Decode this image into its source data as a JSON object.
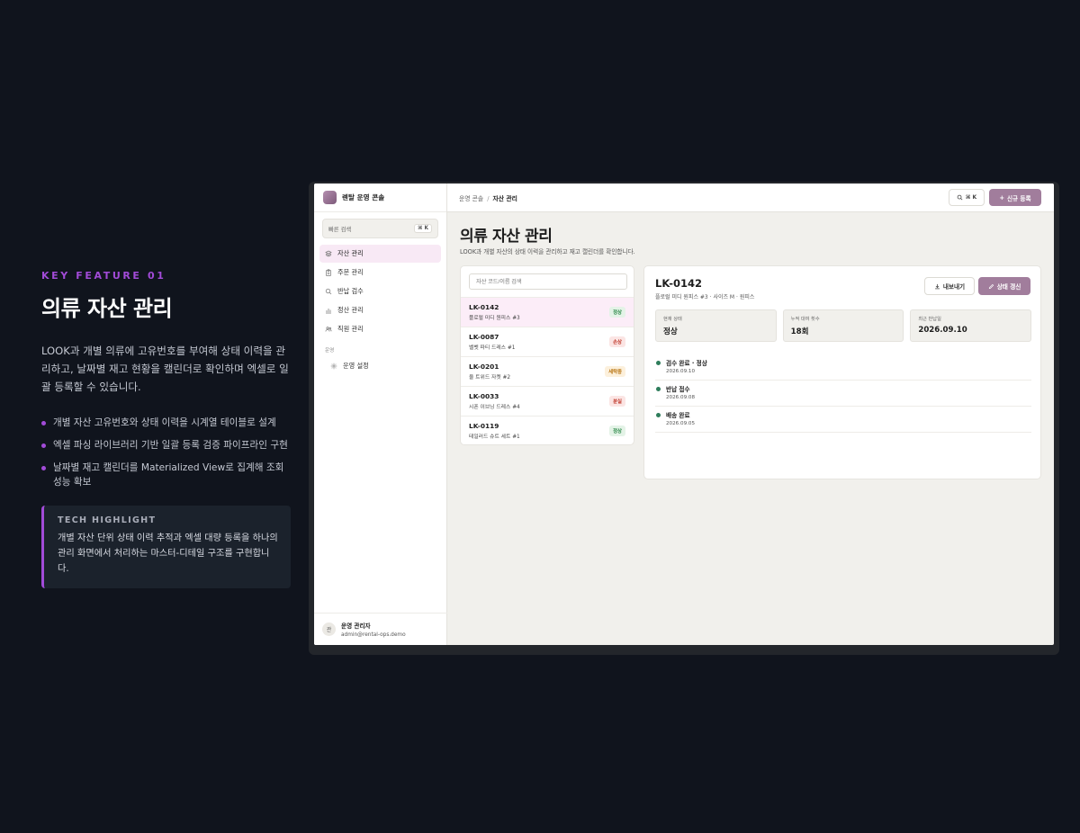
{
  "feature": {
    "kicker": "KEY FEATURE 01",
    "title": "의류 자산 관리",
    "description": "LOOK과 개별 의류에 고유번호를 부여해 상태 이력을 관리하고, 날짜별 재고 현황을 캘린더로 확인하며 엑셀로 일괄 등록할 수 있습니다.",
    "bullets": [
      "개별 자산 고유번호와 상태 이력을 시계열 테이블로 설계",
      "엑셀 파싱 라이브러리 기반 일괄 등록 검증 파이프라인 구현",
      "날짜별 재고 캘린더를 Materialized View로 집계해 조회 성능 확보"
    ],
    "tech": {
      "title": "TECH HIGHLIGHT",
      "description": "개별 자산 단위 상태 이력 추적과 엑셀 대량 등록을 하나의 관리 화면에서 처리하는 마스터-디테일 구조를 구현합니다."
    }
  },
  "app": {
    "brand": "렌탈 운영 콘솔",
    "quick_search": {
      "label": "빠른 검색",
      "shortcut": "⌘ K"
    },
    "nav": [
      {
        "label": "자산 관리",
        "icon": "layers-icon"
      },
      {
        "label": "주문 관리",
        "icon": "clipboard-icon"
      },
      {
        "label": "반납 검수",
        "icon": "search-icon"
      },
      {
        "label": "정산 관리",
        "icon": "bar-chart-icon"
      },
      {
        "label": "직원 관리",
        "icon": "users-icon"
      }
    ],
    "section_label": "운영",
    "settings_label": "운영 설정",
    "user": {
      "initial": "관",
      "name": "운영 관리자",
      "email": "admin@rental-ops.demo"
    },
    "breadcrumb": {
      "root": "운영 콘솔",
      "separator": "/",
      "current": "자산 관리"
    },
    "search_shortcut": "⌘ K",
    "new_button": "신규 등록",
    "page_title": "의류 자산 관리",
    "page_subtitle": "LOOK과 개별 자산의 상태 이력을 관리하고 재고 캘린더를 확인합니다.",
    "list": {
      "search_placeholder": "자산 코드/이름 검색",
      "rows": [
        {
          "id": "LK-0142",
          "name": "플로럴 미디 원피스 #3",
          "status": "정상",
          "status_type": "normal"
        },
        {
          "id": "LK-0087",
          "name": "벨벳 파티 드레스 #1",
          "status": "손상",
          "status_type": "damage"
        },
        {
          "id": "LK-0201",
          "name": "울 트위드 자켓 #2",
          "status": "세탁중",
          "status_type": "wash"
        },
        {
          "id": "LK-0033",
          "name": "시폰 이브닝 드레스 #4",
          "status": "분실",
          "status_type": "damage"
        },
        {
          "id": "LK-0119",
          "name": "테일러드 슈트 세트 #1",
          "status": "정상",
          "status_type": "normal"
        }
      ]
    },
    "detail": {
      "id": "LK-0142",
      "subtitle": "플로럴 미디 원피스 #3 · 사이즈 M · 원피스",
      "export_label": "내보내기",
      "status_update_label": "상태 갱신",
      "stats": [
        {
          "label": "현재 상태",
          "value": "정상"
        },
        {
          "label": "누적 대여 횟수",
          "value": "18회"
        },
        {
          "label": "최근 반납일",
          "value": "2026.09.10"
        }
      ],
      "timeline": [
        {
          "title": "검수 완료 · 정상",
          "date": "2026.09.10"
        },
        {
          "title": "반납 접수",
          "date": "2026.09.08"
        },
        {
          "title": "배송 완료",
          "date": "2026.09.05"
        }
      ]
    },
    "colors": {
      "accent": "#a17d9c",
      "feature_accent": "#a24bd8",
      "timeline_dot": "#2e7d5b"
    }
  }
}
